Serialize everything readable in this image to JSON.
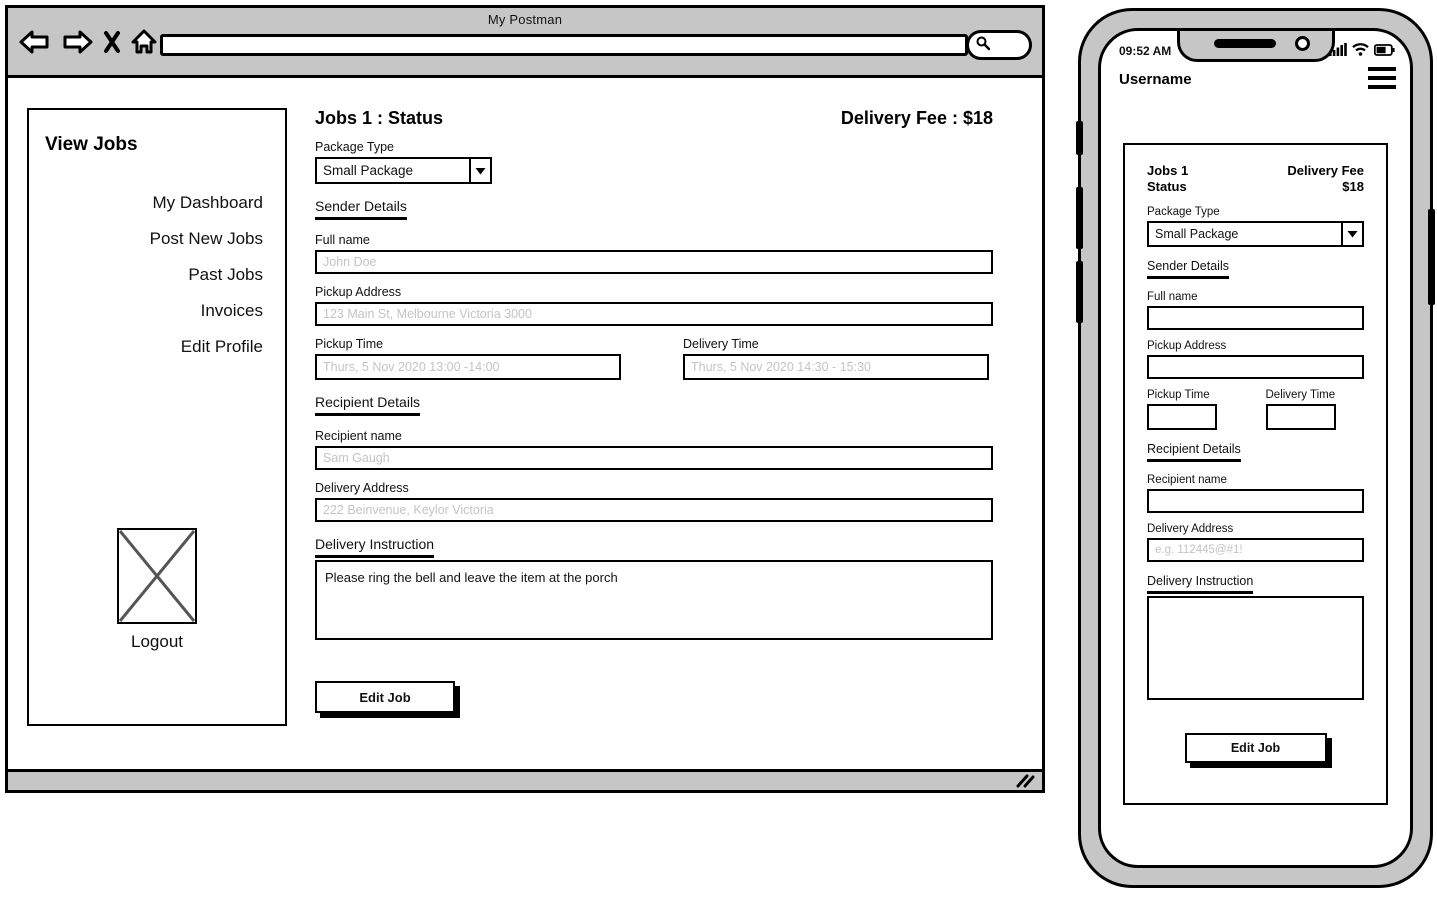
{
  "browser": {
    "title": "My Postman",
    "nav": {
      "back_icon": "back-arrow-icon",
      "forward_icon": "forward-arrow-icon",
      "stop_icon": "close-x-icon",
      "home_icon": "home-icon",
      "search_icon": "search-icon"
    },
    "url_value": "",
    "url_placeholder": ""
  },
  "sidebar": {
    "title": "View Jobs",
    "items": [
      {
        "label": "My Dashboard"
      },
      {
        "label": "Post New Jobs"
      },
      {
        "label": "Past Jobs"
      },
      {
        "label": "Invoices"
      },
      {
        "label": "Edit Profile"
      }
    ],
    "logout_label": "Logout",
    "image_placeholder_icon": "image-placeholder-icon"
  },
  "form": {
    "job_title": "Jobs 1 : Status",
    "delivery_fee": "Delivery Fee : $18",
    "package_type_label": "Package Type",
    "package_type_value": "Small Package",
    "package_type_options": [
      "Small Package"
    ],
    "dropdown_icon": "chevron-down-icon",
    "sender_section": "Sender Details",
    "full_name_label": "Full name",
    "full_name_value": "",
    "full_name_placeholder": "John Doe",
    "pickup_address_label": "Pickup Address",
    "pickup_address_value": "",
    "pickup_address_placeholder": "123 Main St, Melbourne Victoria 3000",
    "pickup_time_label": "Pickup Time",
    "pickup_time_value": "",
    "pickup_time_placeholder": "Thurs, 5 Nov 2020 13:00 -14:00",
    "delivery_time_label": "Delivery Time",
    "delivery_time_value": "",
    "delivery_time_placeholder": "Thurs, 5 Nov 2020 14:30 - 15:30",
    "recipient_section": "Recipient Details",
    "recipient_name_label": "Recipient name",
    "recipient_name_value": "",
    "recipient_name_placeholder": "Sam Gaugh",
    "delivery_address_label": "Delivery Address",
    "delivery_address_value": "",
    "delivery_address_placeholder": "222 Beinvenue, Keylor Victoria",
    "delivery_instruction_section": "Delivery Instruction",
    "delivery_instruction_value": "Please ring the bell and leave the item at the porch",
    "submit_label": "Edit Job"
  },
  "phone": {
    "status_time": "09:52 AM",
    "signal_icon": "signal-bars-icon",
    "wifi_icon": "wifi-icon",
    "battery_icon": "battery-icon",
    "username": "Username",
    "menu_icon": "hamburger-menu-icon",
    "job_title_line1": "Jobs 1",
    "job_title_line2": "Status",
    "fee_line1": "Delivery Fee",
    "fee_line2": "$18",
    "package_type_label": "Package Type",
    "package_type_value": "Small Package",
    "dropdown_icon": "chevron-down-icon",
    "sender_section": "Sender Details",
    "full_name_label": "Full name",
    "full_name_value": "",
    "pickup_address_label": "Pickup Address",
    "pickup_address_value": "",
    "pickup_time_label": "Pickup Time",
    "pickup_time_value": "",
    "delivery_time_label": "Delivery Time",
    "delivery_time_value": "",
    "recipient_section": "Recipient Details",
    "recipient_name_label": "Recipient name",
    "recipient_name_value": "",
    "delivery_address_label": "Delivery Address",
    "delivery_address_value": "",
    "delivery_address_placeholder": "e.g. 112445@#1!",
    "delivery_instruction_section": "Delivery Instruction",
    "delivery_instruction_value": "",
    "submit_label": "Edit Job"
  },
  "colors": {
    "chrome_grey": "#c6c6c6",
    "ink": "#000000",
    "placeholder": "#c4c4c4"
  }
}
